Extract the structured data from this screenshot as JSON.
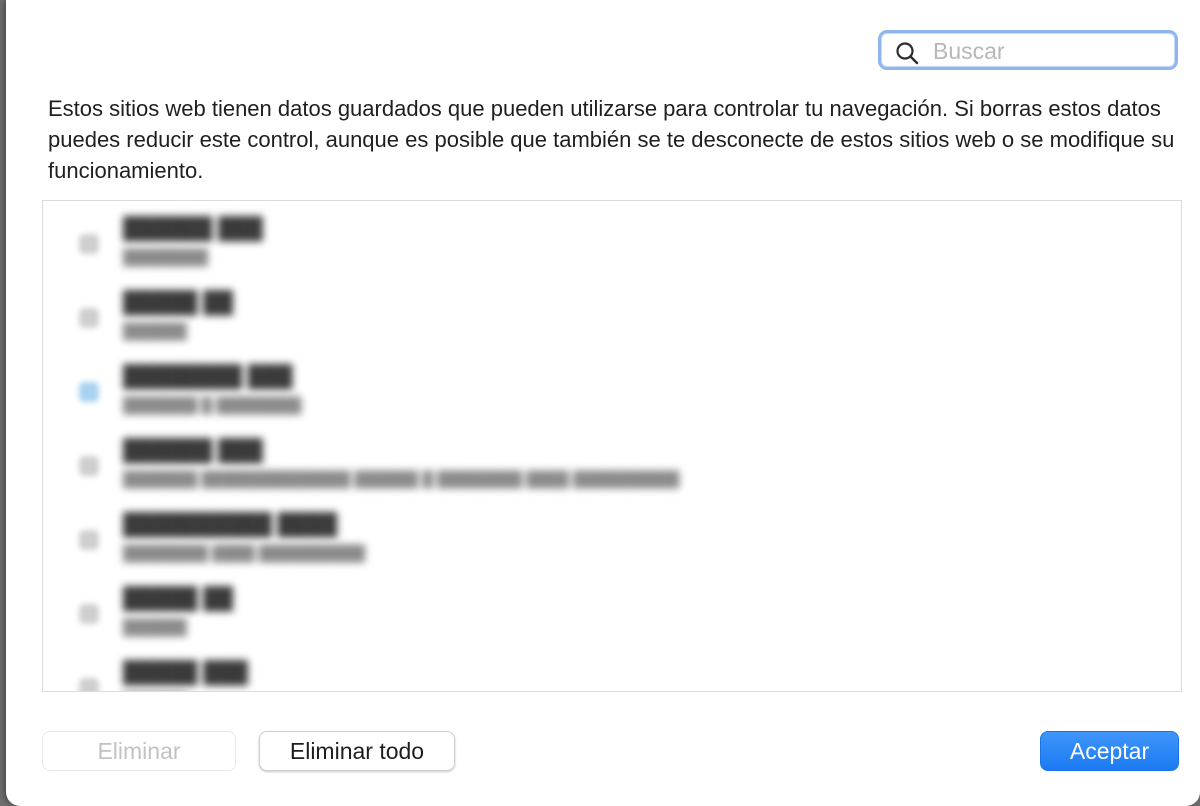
{
  "search": {
    "placeholder": "Buscar",
    "value": "",
    "icon": "magnifying-glass-icon"
  },
  "description": "Estos sitios web tienen datos guardados que pueden utilizarse para controlar tu navegación. Si borras estos datos puedes reducir este control, aunque es posible que también se te desconecte de estos sitios web o se modifique su funcionamiento.",
  "website_list": {
    "rows_visible": 7,
    "blurred": true,
    "items": [
      {
        "name": "",
        "detail": "",
        "icon": "globe-icon"
      },
      {
        "name": "",
        "detail": "",
        "icon": "globe-icon"
      },
      {
        "name": "",
        "detail": "",
        "icon": "site-favicon-blue"
      },
      {
        "name": "",
        "detail": "",
        "icon": "globe-icon"
      },
      {
        "name": "",
        "detail": "",
        "icon": "globe-icon"
      },
      {
        "name": "",
        "detail": "",
        "icon": "globe-icon"
      },
      {
        "name": "",
        "detail": "",
        "icon": "globe-icon"
      }
    ]
  },
  "buttons": {
    "remove": "Eliminar",
    "remove_all": "Eliminar todo",
    "accept": "Aceptar"
  },
  "colors": {
    "accent": "#1b7af2",
    "focus_ring": "#8fb5ef",
    "disabled_text": "#c2c2c2"
  }
}
